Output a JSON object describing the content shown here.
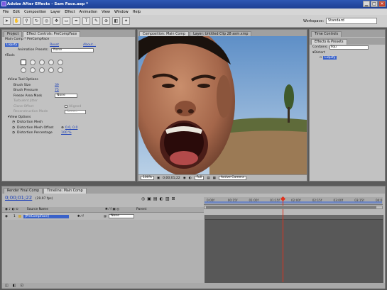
{
  "window": {
    "title": "Adobe After Effects - Sam Face.aep *"
  },
  "menu": [
    "File",
    "Edit",
    "Composition",
    "Layer",
    "Effect",
    "Animation",
    "View",
    "Window",
    "Help"
  ],
  "workspace": {
    "label": "Workspace:",
    "value": "Standard"
  },
  "left_panel": {
    "tabs": [
      "Project",
      "Effect Controls: PreCompFace"
    ],
    "breadcrumb": "Main Comp * PreCompFace",
    "effect_name": "Liquify",
    "reset_label": "Reset",
    "about_label": "About...",
    "animation_presets_label": "Animation Presets:",
    "animation_presets_value": "None",
    "tools_label": "Tools",
    "view_tool_options_label": "View Tool Options",
    "brush_size_label": "Brush Size",
    "brush_size_value": "39",
    "brush_pressure_label": "Brush Pressure",
    "brush_pressure_value": "75",
    "freeze_area_mask_label": "Freeze Area Mask",
    "freeze_area_mask_value": "None",
    "turbulent_jitter_label": "Turbulent Jitter",
    "clone_offset_label": "Clone Offset",
    "clone_offset_value": "Aligned",
    "reconstruction_mode_label": "Reconstruction Mode",
    "reconstruction_mode_value": "Revert",
    "view_options_label": "View Options",
    "distortion_mesh_label": "Distortion Mesh",
    "distortion_mesh_offset_label": "Distortion Mesh Offset",
    "distortion_mesh_offset_value": "0.0, 0.0",
    "distortion_percentage_label": "Distortion Percentage",
    "distortion_percentage_value": "100 %"
  },
  "comp_panel": {
    "tabs": [
      "Composition: Main Comp",
      "Layer: Untitled Clip 28 asm.xmp"
    ],
    "footer": {
      "zoom": "100%",
      "timecode": "0;00;01;22",
      "resolution": "Full",
      "view_label": "Active Camera"
    }
  },
  "right_panel": {
    "tabs": [
      "Time Controls",
      "Effects & Presets"
    ],
    "search_label": "Contains:",
    "search_value": "liqu",
    "tree_folder": "Distort",
    "tree_item": "Liquify"
  },
  "timeline": {
    "tabs": [
      "Render Final Comp",
      "Timeline: Main Comp"
    ],
    "timecode": "0;00;01;22",
    "fps": "(29.97 fps)",
    "col_source_name": "Source Name",
    "col_parent": "Parent",
    "layer_index": "1",
    "layer_name": "[PreCompFace]",
    "parent_value": "None",
    "ruler_ticks": [
      "0:00f",
      "00:15f",
      "01:00f",
      "01:15f",
      "02:00f",
      "02:15f",
      "03:00f",
      "03:15f",
      "04:0"
    ],
    "playhead_fraction": 0.44
  },
  "colors": {
    "title_bar": "#1d3f93",
    "playhead": "#e0321c",
    "selected_layer": "#3a62c9"
  }
}
